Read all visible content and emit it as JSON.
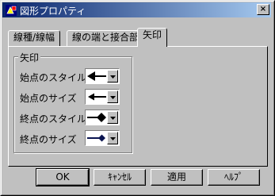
{
  "window": {
    "title": "図形プロパティ",
    "close_label": "×"
  },
  "tabs": [
    {
      "label": "線種/線幅",
      "selected": false
    },
    {
      "label": "線の端と接合部",
      "selected": false
    },
    {
      "label": "矢印",
      "selected": true
    }
  ],
  "arrow_group": {
    "title": "矢印",
    "rows": [
      {
        "label": "始点のスタイル",
        "value_icon": "left-arrow-large-icon"
      },
      {
        "label": "始点のサイズ",
        "value_icon": "left-arrow-small-icon"
      },
      {
        "label": "終点のスタイル",
        "value_icon": "diamond-end-large-icon"
      },
      {
        "label": "終点のサイズ",
        "value_icon": "diamond-end-small-icon"
      }
    ]
  },
  "buttons": {
    "ok": "OK",
    "cancel": "ｷｬﾝｾﾙ",
    "apply": "適用",
    "help": "ﾍﾙﾌﾟ"
  },
  "colors": {
    "title_start": "#08246b",
    "title_end": "#a6caf0",
    "face": "#c0c0c0",
    "arrow_fill": "#000000",
    "diamond_small_fill": "#0a1450"
  }
}
